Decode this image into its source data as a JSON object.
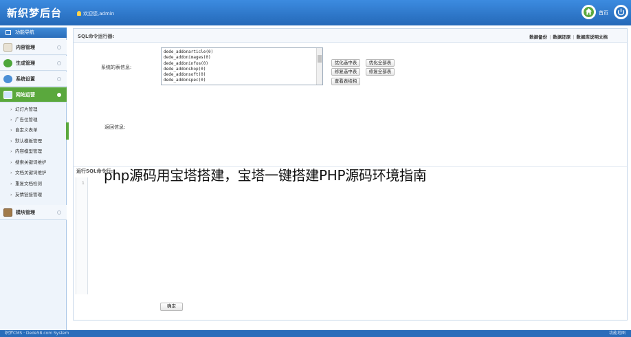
{
  "header": {
    "logo": "新织梦后台",
    "welcome": "欢迎您,admin",
    "home_label": "首页"
  },
  "sidebar": {
    "title": "功能导航",
    "categories": [
      {
        "label": "内容管理"
      },
      {
        "label": "生成管理"
      },
      {
        "label": "系统设置"
      },
      {
        "label": "网站运营"
      },
      {
        "label": "模块管理"
      }
    ],
    "sub_items": [
      {
        "label": "幻灯片管理"
      },
      {
        "label": "广告位管理"
      },
      {
        "label": "自定义表单"
      },
      {
        "label": "默认模板管理"
      },
      {
        "label": "内容模型管理"
      },
      {
        "label": "搜索关键词维护"
      },
      {
        "label": "文档关键词维护"
      },
      {
        "label": "重复文档检测"
      },
      {
        "label": "友情链接管理"
      }
    ]
  },
  "main": {
    "title": "SQL命令运行器:",
    "links": [
      "数据备份",
      "数据还原",
      "数据库说明文档"
    ],
    "tables_label": "系统的表信息:",
    "tables": [
      "dede_addonarticle(0)",
      "dede_addonimages(0)",
      "dede_addoninfos(0)",
      "dede_addonshop(0)",
      "dede_addonsoft(0)",
      "dede_addonspec(0)"
    ],
    "buttons": {
      "optimize_selected": "优化选中表",
      "optimize_all": "优化全部表",
      "repair_selected": "修复选中表",
      "repair_all": "修复全部表",
      "view_structure": "查看表结构"
    },
    "result_label": "返回信息:",
    "sql_section_title": "运行SQL命令行:",
    "editor_line": "1",
    "ok_button": "确定"
  },
  "overlay_caption": "php源码用宝塔搭建，宝塔一键搭建PHP源码环境指南",
  "footer": {
    "left": "织梦CMS · Dede58.com System",
    "right": "功能地图"
  }
}
